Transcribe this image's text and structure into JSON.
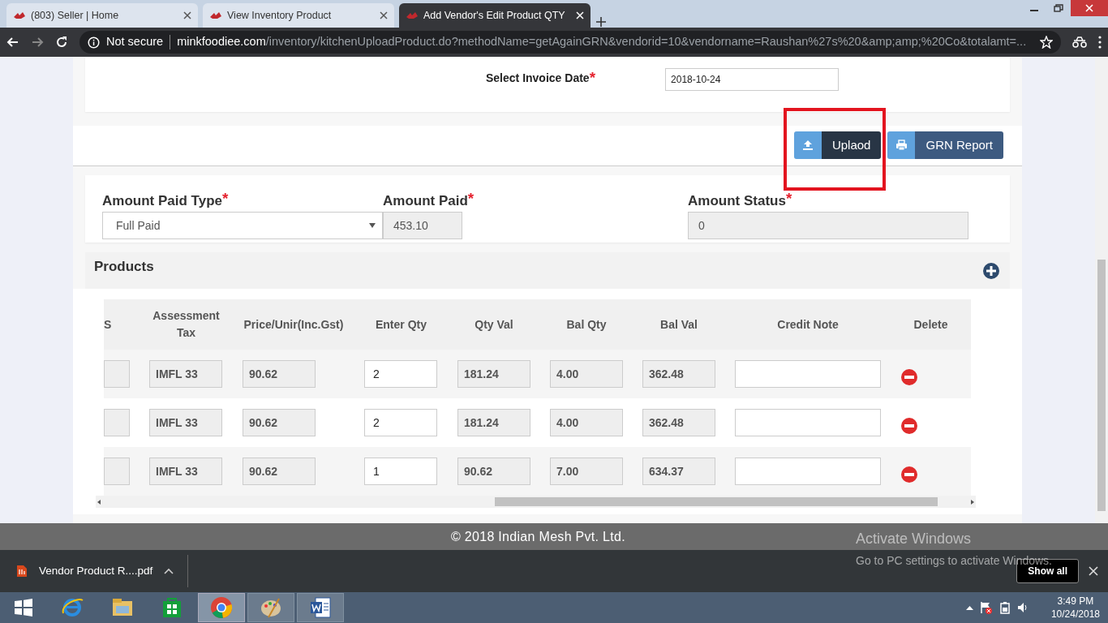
{
  "browser": {
    "tabs": [
      {
        "title": "(803) Seller | Home",
        "selected": false
      },
      {
        "title": "View Inventory Product",
        "selected": false
      },
      {
        "title": "Add Vendor's Edit Product QTY",
        "selected": true
      }
    ],
    "security": "Not secure",
    "url_domain": "minkfoodiee.com",
    "url_path": "/inventory/kitchenUploadProduct.do?methodName=getAgainGRN&vendorid=10&vendorname=Raushan%27s%20&amp;amp;%20Co&totalamt=..."
  },
  "invoice_date": {
    "label": "Select Invoice Date",
    "required_mark": "*",
    "value": "2018-10-24"
  },
  "buttons": [
    {
      "label": "Uplaod",
      "kind": "upload"
    },
    {
      "label": "GRN Report",
      "kind": "print"
    }
  ],
  "payment_fields": [
    {
      "label": "Amount Paid Type",
      "required_mark": "*",
      "kind": "select",
      "value": "Full Paid"
    },
    {
      "label": "Amount Paid",
      "required_mark": "*",
      "kind": "readonly",
      "value": "453.10"
    },
    {
      "label": "Amount Status",
      "required_mark": "*",
      "kind": "readonly",
      "value": "0"
    }
  ],
  "products": {
    "title": "Products",
    "columns": [
      "S",
      "Assessment Tax",
      "Price/Unir(Inc.Gst)",
      "Enter Qty",
      "Qty Val",
      "Bal Qty",
      "Bal Val",
      "Credit Note",
      "Delete"
    ],
    "rows": [
      {
        "assessment_tax": "IMFL 33",
        "price": "90.62",
        "enter_qty": "2",
        "qty_val": "181.24",
        "bal_qty": "4.00",
        "bal_val": "362.48"
      },
      {
        "assessment_tax": "IMFL 33",
        "price": "90.62",
        "enter_qty": "2",
        "qty_val": "181.24",
        "bal_qty": "4.00",
        "bal_val": "362.48"
      },
      {
        "assessment_tax": "IMFL 33",
        "price": "90.62",
        "enter_qty": "1",
        "qty_val": "90.62",
        "bal_qty": "7.00",
        "bal_val": "634.37"
      }
    ]
  },
  "footer": "© 2018 Indian Mesh Pvt. Ltd.",
  "os_notice": {
    "title": "Activate Windows",
    "text": "Go to PC settings to activate Windows."
  },
  "downloads": {
    "file": "Vendor Product R....pdf",
    "show_all": "Show all"
  },
  "taskbar": {
    "time": "3:49 PM",
    "date": "10/24/2018"
  }
}
